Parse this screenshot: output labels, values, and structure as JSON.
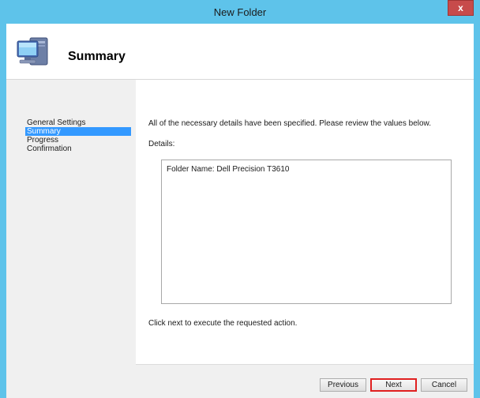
{
  "window": {
    "title": "New Folder",
    "close_label": "x"
  },
  "header": {
    "title": "Summary",
    "icon": "computer-icon"
  },
  "nav": {
    "items": [
      {
        "label": "General Settings",
        "selected": false
      },
      {
        "label": "Summary",
        "selected": true
      },
      {
        "label": "Progress",
        "selected": false
      },
      {
        "label": "Confirmation",
        "selected": false
      }
    ]
  },
  "content": {
    "intro": "All of the necessary details have been specified.  Please review the values below.",
    "details_label": "Details:",
    "details_text": "Folder Name:  Dell Precision T3610",
    "next_hint": "Click next to execute the requested action."
  },
  "footer": {
    "previous_label": "Previous",
    "next_label": "Next",
    "cancel_label": "Cancel"
  },
  "colors": {
    "title_bar": "#5ec3ea",
    "selection": "#3399ff",
    "highlight": "#e02020"
  }
}
